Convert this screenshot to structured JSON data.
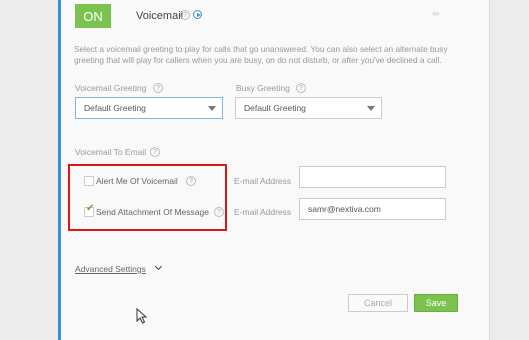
{
  "header": {
    "toggle_label": "ON",
    "title": "Voicemail",
    "help_glyph": "?"
  },
  "description": "Select a voicemail greeting to play for calls that go unanswered. You can also select an alternate busy greeting that will play for callers when you are busy, on do not disturb, or after you've declined a call.",
  "greetings": {
    "voicemail_label": "Voicemail Greeting",
    "voicemail_value": "Default Greeting",
    "busy_label": "Busy Greeting",
    "busy_value": "Default Greeting"
  },
  "email_section": {
    "heading": "Voicemail To Email",
    "alert": {
      "label": "Alert Me Of Voicemail",
      "checked": false,
      "email_label": "E-mail Address",
      "email_value": ""
    },
    "attachment": {
      "label": "Send Attachment Of Message",
      "checked": true,
      "email_label": "E-mail Address",
      "email_value": "samr@nextiva.com"
    }
  },
  "advanced_link": "Advanced Settings",
  "buttons": {
    "cancel": "Cancel",
    "save": "Save"
  },
  "colors": {
    "accent_green": "#7cc24f",
    "accent_blue": "#3f8fd2",
    "highlight_red": "#e01616"
  }
}
